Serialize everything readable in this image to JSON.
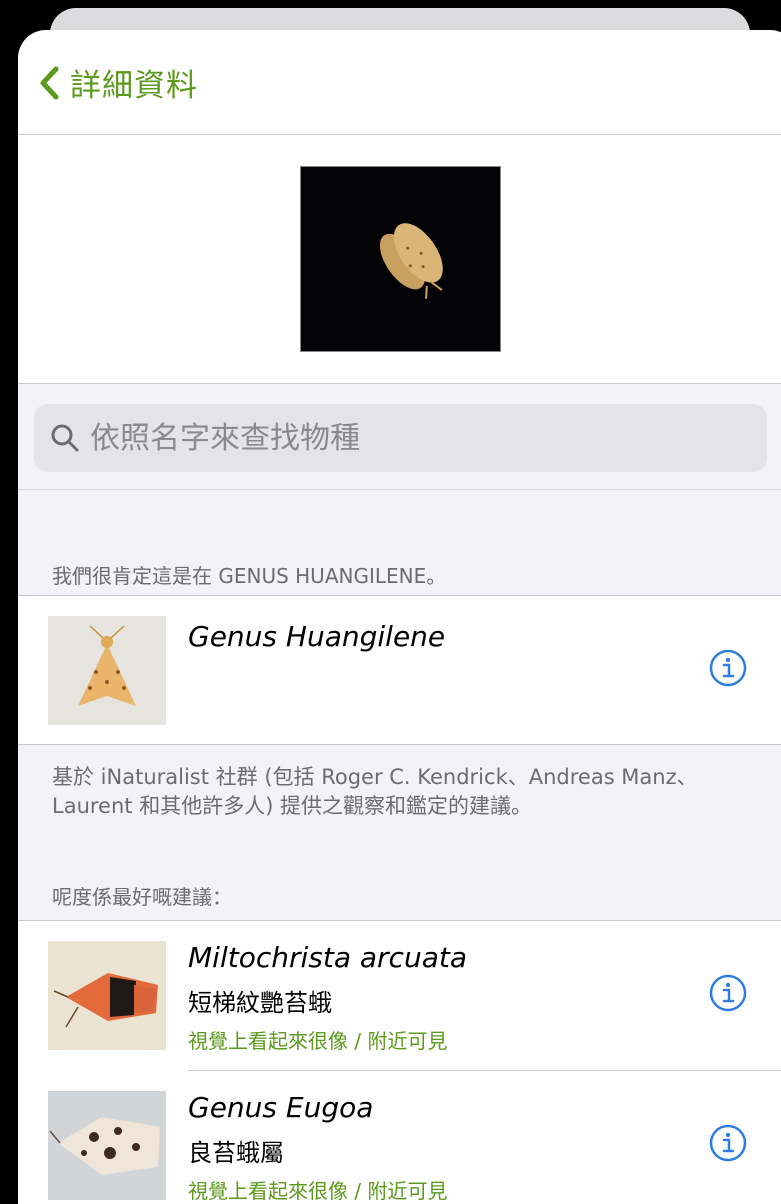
{
  "nav": {
    "back_label": "詳細資料"
  },
  "search": {
    "placeholder": "依照名字來查找物種"
  },
  "top_suggestion": {
    "header": "我們很肯定這是在 GENUS HUANGILENE。",
    "name": "Genus Huangilene"
  },
  "attribution": "基於 iNaturalist 社群 (包括 Roger C. Kendrick、Andreas Manz、Laurent 和其他許多人) 提供之觀察和鑑定的建議。",
  "best_suggestions": {
    "header": "呢度係最好嘅建議：",
    "items": [
      {
        "name": "Miltochrista arcuata",
        "common": "短梯紋艷苔蛾",
        "reason": "視覺上看起來很像 / 附近可見"
      },
      {
        "name": "Genus Eugoa",
        "common": "良苔蛾屬",
        "reason": "視覺上看起來很像 / 附近可見"
      }
    ]
  },
  "colors": {
    "accent": "#5c9a1e",
    "info_blue": "#2f7de1"
  },
  "icons": [
    "chevron-left-icon",
    "search-icon",
    "info-icon"
  ]
}
